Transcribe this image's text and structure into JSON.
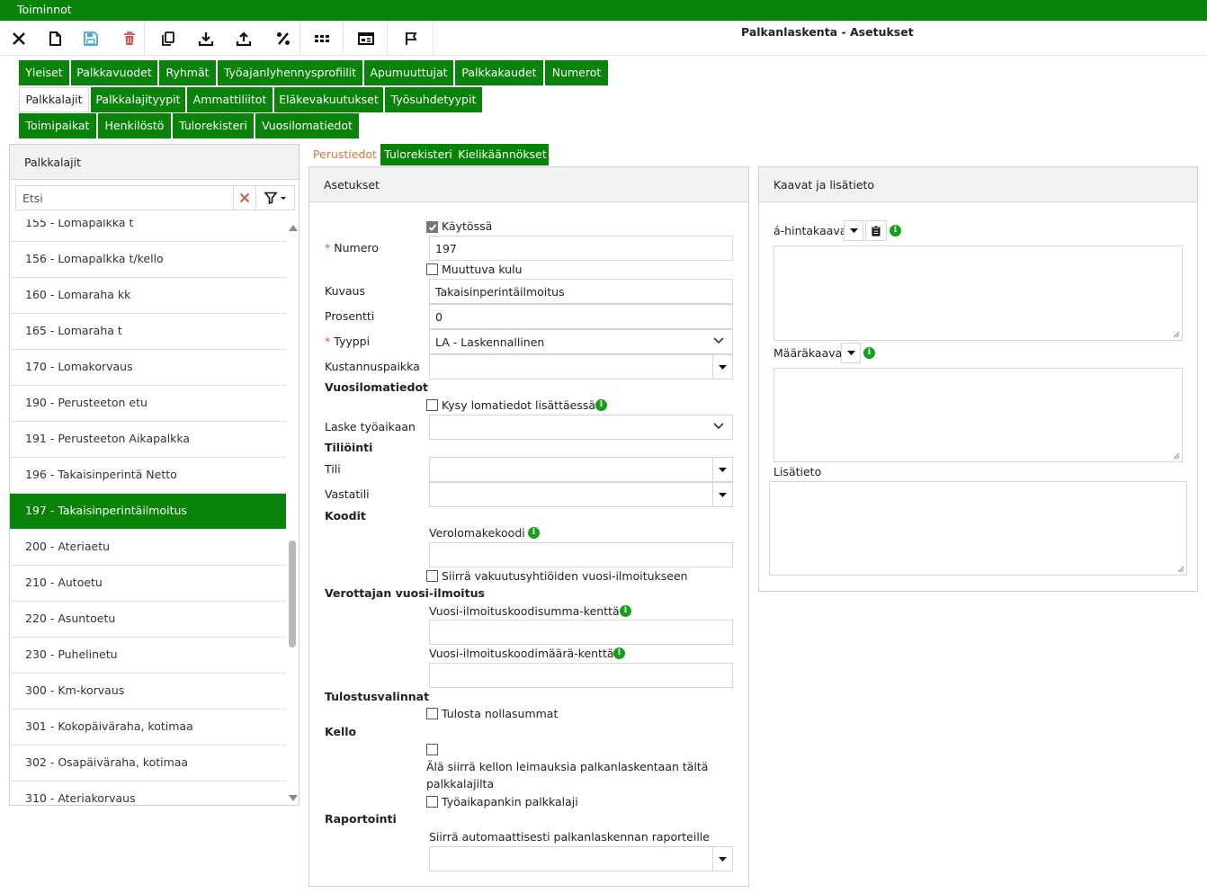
{
  "menubar": {
    "title": "Toiminnot"
  },
  "app": {
    "title": "Palkanlaskenta - Asetukset"
  },
  "toolbar": {
    "icons": [
      "close-icon",
      "new-document-icon",
      "save-icon",
      "delete-icon",
      "copy-icon",
      "download-icon",
      "upload-icon",
      "percent-icon",
      "grid-icon",
      "card-icon",
      "flag-icon"
    ]
  },
  "nav_tabs": {
    "row1": [
      "Yleiset",
      "Palkkavuodet",
      "Ryhmät",
      "Työajanlyhennysprofiilit",
      "Apumuuttujat",
      "Palkkakaudet",
      "Numerot"
    ],
    "row2": [
      "Palkkalajit",
      "Palkkalajityypit",
      "Ammattiliitot",
      "Eläkevakuutukset",
      "Työsuhdetyypit"
    ],
    "row3": [
      "Toimipaikat",
      "Henkilöstö",
      "Tulorekisteri",
      "Vuosilomatiedot"
    ],
    "active": "Palkkalajit"
  },
  "left_panel": {
    "title": "Palkkalajit",
    "search_placeholder": "Etsi",
    "items": [
      "155 - Lomapalkka t",
      "156 - Lomapalkka t/kello",
      "160 - Lomaraha kk",
      "165 - Lomaraha t",
      "170 - Lomakorvaus",
      "190 - Perusteeton etu",
      "191 - Perusteeton Aikapalkka",
      "196 - Takaisinperintä Netto",
      "197 - Takaisinperintäilmoitus",
      "200 - Ateriaetu",
      "210 - Autoetu",
      "220 - Asuntoetu",
      "230 - Puhelinetu",
      "300 - Km-korvaus",
      "301 - Kokopäiväraha, kotimaa",
      "302 - Osapäiväraha, kotimaa",
      "310 - Ateriakorvaus"
    ],
    "selected": "197 - Takaisinperintäilmoitus"
  },
  "sub_tabs": [
    "Perustiedot",
    "Tulorekisteri",
    "Kielikäännökset"
  ],
  "asetukset": {
    "title": "Asetukset",
    "kaytossa": {
      "label": "Käytössä",
      "checked": true
    },
    "numero": {
      "label": "Numero",
      "value": "197"
    },
    "muuttuva_kulu": {
      "label": "Muuttuva kulu",
      "checked": false
    },
    "kuvaus": {
      "label": "Kuvaus",
      "value": "Takaisinperintäilmoitus"
    },
    "prosentti": {
      "label": "Prosentti",
      "value": "0"
    },
    "tyyppi": {
      "label": "Tyyppi",
      "value": "LA - Laskennallinen"
    },
    "kustannuspaikka": {
      "label": "Kustannuspaikka",
      "value": ""
    },
    "vuosilomatiedot": {
      "section": "Vuosilomatiedot",
      "kysy_label": "Kysy lomatiedot lisättäessä",
      "laske_label": "Laske työaikaan",
      "laske_value": ""
    },
    "tiliointi": {
      "section": "Tiliöinti",
      "tili_label": "Tili",
      "vastatili_label": "Vastatili"
    },
    "koodit": {
      "section": "Koodit",
      "verolomake_label": "Verolomakekoodi",
      "siirra_label": "Siirrä vakuutusyhtiöiden vuosi-ilmoitukseen"
    },
    "verottaja": {
      "section": "Verottajan vuosi-ilmoitus",
      "summa_label": "Vuosi-ilmoituskoodisumma-kenttä",
      "maara_label": "Vuosi-ilmoituskoodimäärä-kenttä"
    },
    "tulostus": {
      "section": "Tulostusvalinnat",
      "nolla_label": "Tulosta nollasummat"
    },
    "kello": {
      "section": "Kello",
      "ala_siirra_line1": "Älä siirrä kellon leimauksia palkanlaskentaan tältä",
      "ala_siirra_line2": "palkkalajilta",
      "tyoaikapankki_label": "Työaikapankin palkkalaji"
    },
    "raportointi": {
      "section": "Raportointi",
      "siirra_label": "Siirrä automaattisesti palkanlaskennan raporteille"
    }
  },
  "kaavat": {
    "title": "Kaavat ja lisätieto",
    "hintakaava_label": "á-hintakaava",
    "maarakaava_label": "Määräkaava",
    "lisatieto_label": "Lisätieto"
  },
  "colors": {
    "primary": "#098309",
    "active_tab_text": "#e0733a",
    "delete": "#d9534f",
    "save": "#4aa3df"
  }
}
